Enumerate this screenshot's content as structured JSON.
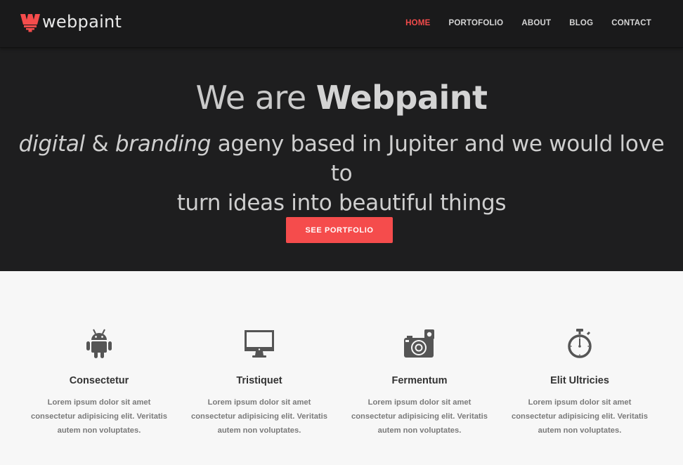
{
  "brand": {
    "name": "webpaint",
    "logo_letter": "W",
    "logo_icon": "brush-w-logo-icon",
    "accent": "#f54c4c"
  },
  "nav": {
    "items": [
      {
        "label": "HOME",
        "active": true
      },
      {
        "label": "PORTOFOLIO",
        "active": false
      },
      {
        "label": "ABOUT",
        "active": false
      },
      {
        "label": "BLOG",
        "active": false
      },
      {
        "label": "CONTACT",
        "active": false
      }
    ]
  },
  "hero": {
    "title_light": "We are",
    "title_strong": "Webpaint",
    "sub_em1": "digital",
    "sub_amp": "&",
    "sub_em2": "branding",
    "sub_rest1": "ageny based in Jupiter and we would love to",
    "sub_rest2": "turn ideas into beautiful things",
    "cta_label": "SEE PORTFOLIO"
  },
  "features": [
    {
      "icon": "android-icon",
      "title": "Consectetur",
      "text": "Lorem ipsum dolor sit amet consectetur adipisicing elit. Veritatis autem non voluptates."
    },
    {
      "icon": "desktop-monitor-icon",
      "title": "Tristiquet",
      "text": "Lorem ipsum dolor sit amet consectetur adipisicing elit. Veritatis autem non voluptates."
    },
    {
      "icon": "camera-icon",
      "title": "Fermentum",
      "text": "Lorem ipsum dolor sit amet consectetur adipisicing elit. Veritatis autem non voluptates."
    },
    {
      "icon": "stopwatch-icon",
      "title": "Elit Ultricies",
      "text": "Lorem ipsum dolor sit amet consectetur adipisicing elit. Veritatis autem non voluptates."
    }
  ],
  "colors": {
    "nav_bg": "#1a1a1b",
    "hero_bg": "#1e1e1f",
    "accent": "#f24b4b",
    "features_bg": "#f7f7f7",
    "icon_color": "#555555"
  }
}
